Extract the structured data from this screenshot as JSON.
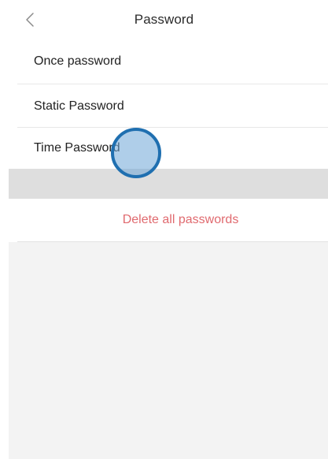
{
  "header": {
    "title": "Password",
    "back_icon": "chevron-left-icon"
  },
  "password_types": [
    {
      "label": "Once password"
    },
    {
      "label": "Static Password"
    },
    {
      "label": "Time Password"
    }
  ],
  "actions": {
    "delete_all_label": "Delete all passwords"
  },
  "colors": {
    "background": "#ffffff",
    "title_text": "#2b2b2b",
    "row_text": "#222222",
    "danger_text": "#e06a6f",
    "section_band": "#dedede",
    "empty_area": "#f3f3f3",
    "touch_ring": "#1f6fb0",
    "touch_fill": "#6ea5d7"
  }
}
